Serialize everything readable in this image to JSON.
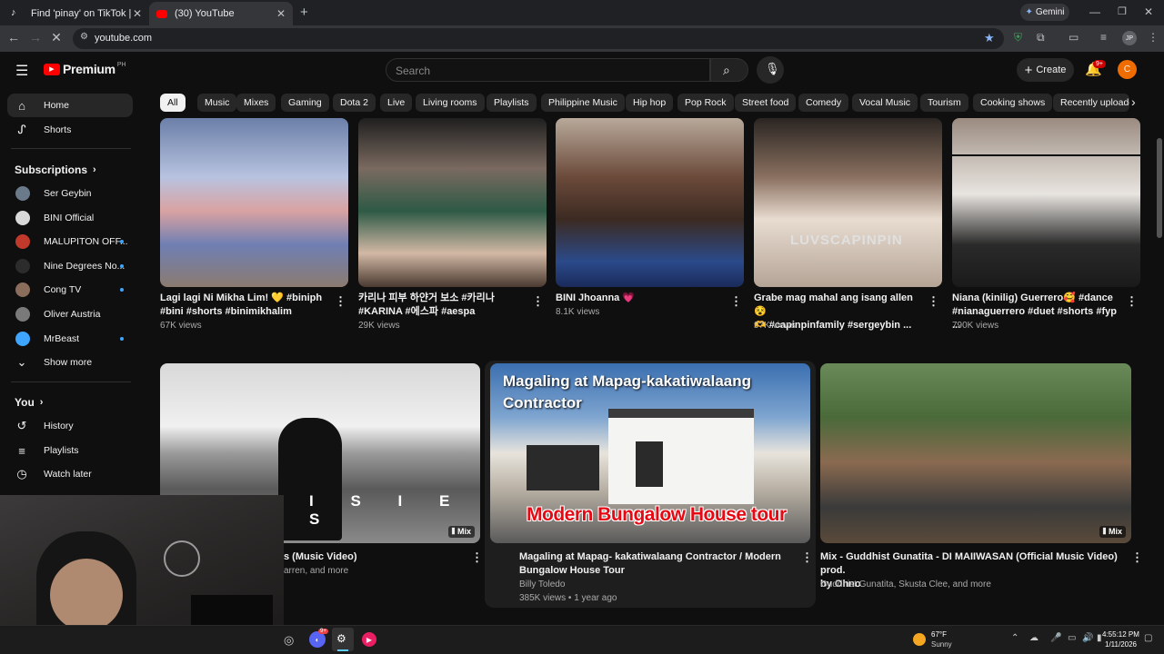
{
  "browser": {
    "tabs": [
      {
        "title": "Find 'pinay' on TikTok | TikTok S",
        "active": false
      },
      {
        "title": "(30) YouTube",
        "active": true
      }
    ],
    "url": "youtube.com",
    "gemini_label": "Gemini",
    "profile_initials": "JP"
  },
  "header": {
    "logo_text": "Premium",
    "region": "PH",
    "search_placeholder": "Search",
    "create_label": "Create",
    "notification_count": "9+",
    "avatar_letter": "C"
  },
  "chips": [
    "All",
    "Music",
    "Mixes",
    "Gaming",
    "Dota 2",
    "Live",
    "Living rooms",
    "Playlists",
    "Philippine Music",
    "Hip hop",
    "Pop Rock",
    "Street food",
    "Comedy",
    "Vocal Music",
    "Tourism",
    "Cooking shows",
    "Recently uploaded"
  ],
  "sidebar": {
    "main": [
      {
        "label": "Home",
        "icon": "home-icon"
      },
      {
        "label": "Shorts",
        "icon": "shorts-icon"
      }
    ],
    "subscriptions_label": "Subscriptions",
    "subscriptions": [
      {
        "label": "Ser Geybin",
        "dot": false,
        "color": "#6b7a8a"
      },
      {
        "label": "BINI Official",
        "dot": false,
        "color": "#d9d9d9"
      },
      {
        "label": "MALUPITON OFF...",
        "dot": true,
        "color": "#c0392b"
      },
      {
        "label": "Nine Degrees No...",
        "dot": true,
        "color": "#2c2c2c"
      },
      {
        "label": "Cong TV",
        "dot": true,
        "color": "#8a6d5a"
      },
      {
        "label": "Oliver Austria",
        "dot": false,
        "color": "#7a7a7a"
      },
      {
        "label": "MrBeast",
        "dot": true,
        "color": "#3ea6ff"
      }
    ],
    "show_more": "Show more",
    "you_label": "You",
    "you_items": [
      {
        "label": "History",
        "icon": "history-icon"
      },
      {
        "label": "Playlists",
        "icon": "playlists-icon"
      },
      {
        "label": "Watch later",
        "icon": "watch-later-icon"
      }
    ]
  },
  "shorts_row": [
    {
      "title_line1": "Lagi lagi Ni Mikha Lim! 💛 #biniph",
      "title_line2": "#bini #shorts #binimikhalim",
      "views": "67K views"
    },
    {
      "title_line1": "카리나 피부 하얀거 보소 #카리나",
      "title_line2": "#KARINA #에스파 #aespa",
      "views": "29K views"
    },
    {
      "title_line1": "BINI Jhoanna 💗",
      "title_line2": "",
      "views": "8.1K views"
    },
    {
      "title_line1": "Grabe mag mahal ang isang allen😵",
      "title_line2": "🫶 #capinpinfamily #sergeybin ...",
      "views": "97K views",
      "overlay_text": "LUVSCAPINPIN"
    },
    {
      "title_line1": "Niana (kinilig) Guerrero🥰 #dance",
      "title_line2": "#nianaguerrero #duet #shorts #fyp ...",
      "views": "790K views"
    }
  ],
  "videos_row": [
    {
      "title_line1": "s (Music Video)",
      "title_line2": "",
      "meta1": "arren, and more",
      "meta2": "",
      "badge": "Mix",
      "overlay_text": "I S I E S"
    },
    {
      "title_line1": "Magaling at Mapag- kakatiwalaang  Contractor / Modern",
      "title_line2": "Bungalow House Tour",
      "meta1": "Billy Toledo",
      "meta2": "385K views • 1 year ago",
      "thumb_top_text": "Magaling at Mapag-kakatiwalaang Contractor",
      "thumb_bottom_text": "Modern Bungalow House tour"
    },
    {
      "title_line1": "Mix - Guddhist Gunatita - DI MAIIWASAN (Official Music Video) prod.",
      "title_line2": "by Ohno",
      "meta1": "Guddhist Gunatita, Skusta Clee, and more",
      "meta2": "",
      "badge": "Mix"
    }
  ],
  "taskbar": {
    "temperature": "67°F",
    "weather": "Sunny",
    "time": "4:55:12 PM",
    "date": "1/11/2026",
    "discord_badge": "9+"
  }
}
